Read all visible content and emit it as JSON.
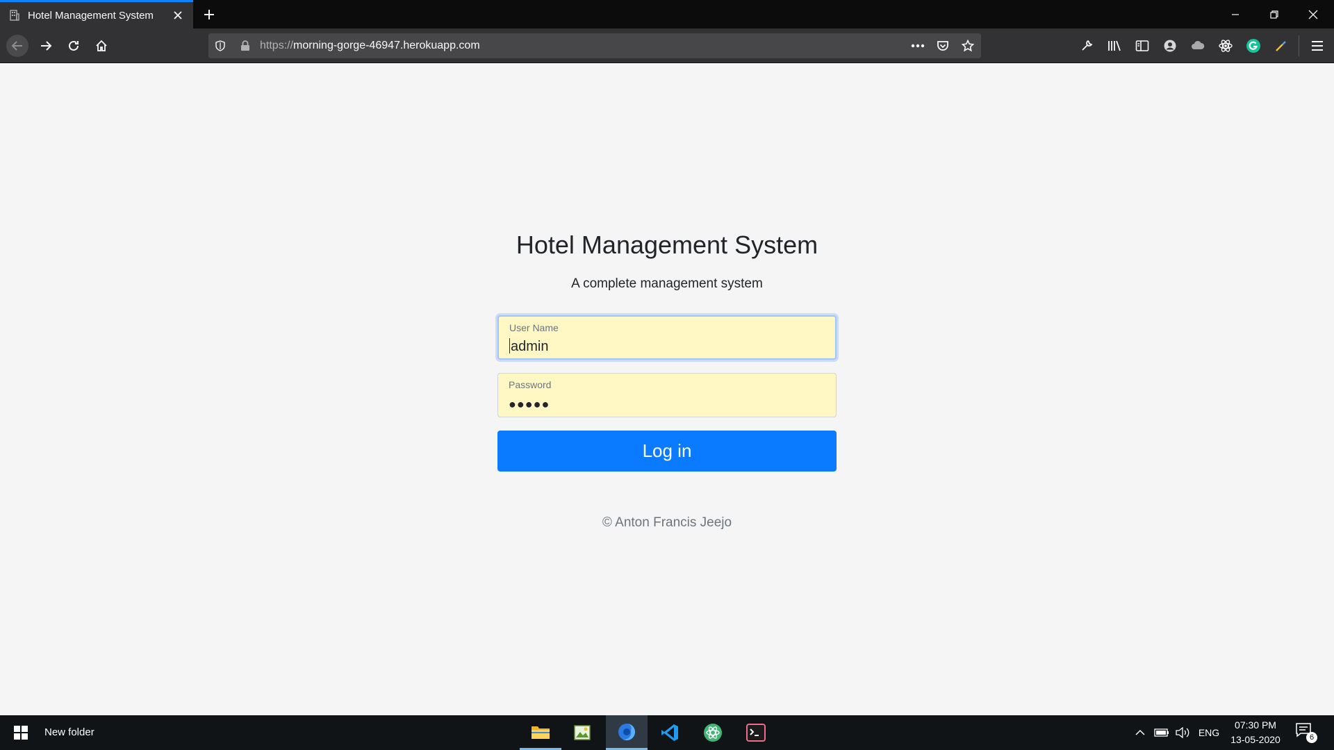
{
  "browser": {
    "tab_title": "Hotel Management System",
    "url_scheme": "https://",
    "url_host": "morning-gorge-46947.herokuapp.com",
    "accent_color": "#0a84ff"
  },
  "page": {
    "title": "Hotel Management System",
    "subtitle": "A complete management system",
    "username": {
      "label": "User Name",
      "value": "admin"
    },
    "password": {
      "label": "Password",
      "masked_value": "●●●●●"
    },
    "login_label": "Log in",
    "footer": "© Anton Francis Jeejo",
    "button_color": "#0a7bff",
    "autofill_color": "#fff8c4"
  },
  "taskbar": {
    "folder_label": "New folder",
    "language": "ENG",
    "time": "07:30 PM",
    "date": "13-05-2020",
    "notification_count": "6",
    "apps": [
      "file-explorer-icon",
      "photos-icon",
      "firefox-icon",
      "vscode-icon",
      "atom-icon",
      "terminal-icon"
    ]
  }
}
